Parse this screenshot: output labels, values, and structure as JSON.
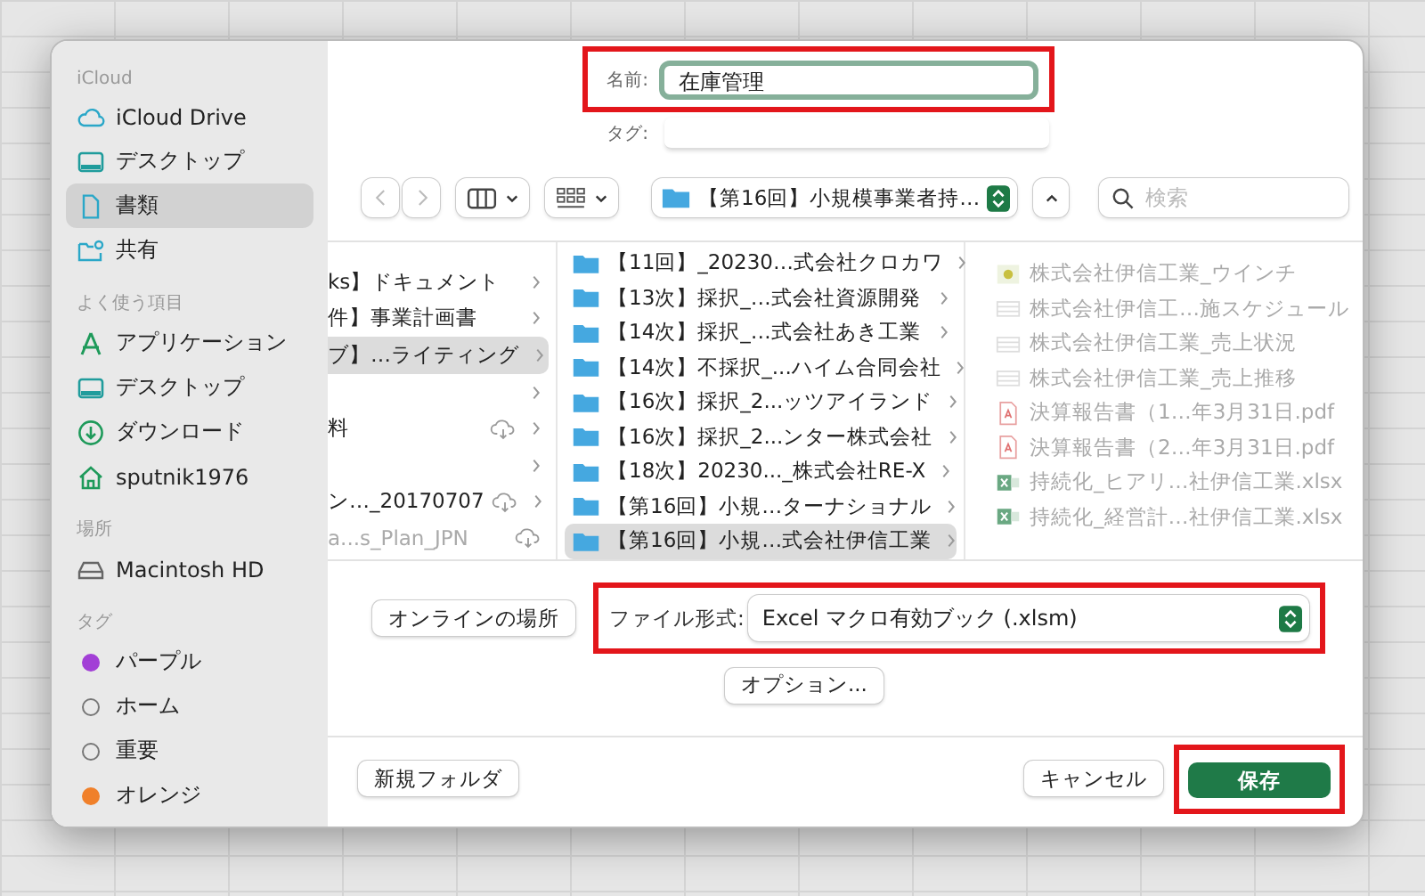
{
  "sidebar": {
    "sections": [
      {
        "heading": "iCloud",
        "items": [
          {
            "kind": "cloud",
            "label": "iCloud Drive",
            "selected": false
          },
          {
            "kind": "desktop",
            "label": "デスクトップ",
            "selected": false
          },
          {
            "kind": "document",
            "label": "書類",
            "selected": true
          },
          {
            "kind": "shared",
            "label": "共有",
            "selected": false
          }
        ]
      },
      {
        "heading": "よく使う項目",
        "items": [
          {
            "kind": "apps",
            "label": "アプリケーション",
            "selected": false
          },
          {
            "kind": "desktop",
            "label": "デスクトップ",
            "selected": false
          },
          {
            "kind": "download",
            "label": "ダウンロード",
            "selected": false
          },
          {
            "kind": "home",
            "label": "sputnik1976",
            "selected": false
          }
        ]
      },
      {
        "heading": "場所",
        "items": [
          {
            "kind": "drive",
            "label": "Macintosh HD",
            "selected": false
          }
        ]
      },
      {
        "heading": "タグ",
        "items": [
          {
            "kind": "tag",
            "color": "#a23fd6",
            "label": "パープル",
            "selected": false
          },
          {
            "kind": "tag",
            "label": "ホーム",
            "selected": false
          },
          {
            "kind": "tag",
            "label": "重要",
            "selected": false
          },
          {
            "kind": "tag",
            "color": "#f0802a",
            "label": "オレンジ",
            "selected": false
          }
        ]
      }
    ]
  },
  "save_form": {
    "name_label": "名前:",
    "name_value": "在庫管理",
    "name_highlighted": true,
    "tag_label": "タグ:"
  },
  "toolbar": {
    "nav_buttons": [
      {
        "kind": "back",
        "disabled": true
      },
      {
        "kind": "forward",
        "disabled": true
      }
    ],
    "path": "【第16回】小規模事業者持…",
    "search_placeholder": "検索"
  },
  "columns": [
    {
      "items": [
        {
          "label": "ks】ドキュメント",
          "kind": "item",
          "chevron": true,
          "cloud": false,
          "disabled": false,
          "selected": false
        },
        {
          "label": "件】事業計画書",
          "kind": "item",
          "chevron": true,
          "cloud": false,
          "disabled": false,
          "selected": false
        },
        {
          "label": "ブ】…ライティング",
          "kind": "item",
          "chevron": true,
          "cloud": false,
          "disabled": false,
          "selected": true
        },
        {
          "kind": "item",
          "chevron": true,
          "cloud": false,
          "disabled": false,
          "selected": false
        },
        {
          "label": "料",
          "kind": "item",
          "chevron": true,
          "cloud": true,
          "disabled": false,
          "selected": false
        },
        {
          "kind": "item",
          "chevron": true,
          "cloud": false,
          "disabled": false,
          "selected": false
        },
        {
          "label": "ン…_20170707",
          "kind": "item",
          "chevron": true,
          "cloud": true,
          "disabled": false,
          "selected": false
        },
        {
          "label": "a...s_Plan_JPN",
          "kind": "item",
          "chevron": false,
          "cloud": true,
          "disabled": true,
          "selected": false
        }
      ]
    },
    {
      "items": [
        {
          "label": "【11回】_20230…式会社クロカワ",
          "kind": "folder",
          "chevron": true,
          "cloud": false,
          "disabled": false,
          "selected": false
        },
        {
          "label": "【13次】採択_…式会社資源開発",
          "kind": "folder",
          "chevron": true,
          "cloud": false,
          "disabled": false,
          "selected": false
        },
        {
          "label": "【14次】採択_…式会社あき工業",
          "kind": "folder",
          "chevron": true,
          "cloud": false,
          "disabled": false,
          "selected": false
        },
        {
          "label": "【14次】不採択_...ハイム合同会社",
          "kind": "folder",
          "chevron": true,
          "cloud": false,
          "disabled": false,
          "selected": false
        },
        {
          "label": "【16次】採択_2...ッツアイランド",
          "kind": "folder",
          "chevron": true,
          "cloud": false,
          "disabled": false,
          "selected": false
        },
        {
          "label": "【16次】採択_2...ンター株式会社",
          "kind": "folder",
          "chevron": true,
          "cloud": false,
          "disabled": false,
          "selected": false
        },
        {
          "label": "【18次】20230..._株式会社RE-X",
          "kind": "folder",
          "chevron": true,
          "cloud": false,
          "disabled": false,
          "selected": false
        },
        {
          "label": "【第16回】小規…ターナショナル",
          "kind": "folder",
          "chevron": true,
          "cloud": false,
          "disabled": false,
          "selected": false
        },
        {
          "label": "【第16回】小規…式会社伊信工業",
          "kind": "folder",
          "chevron": true,
          "cloud": false,
          "disabled": false,
          "selected": true
        }
      ]
    },
    {
      "items": [
        {
          "label": "株式会社伊信工業_ウインチ",
          "kind": "image",
          "chevron": false,
          "cloud": false,
          "disabled": true,
          "selected": false
        },
        {
          "label": "株式会社伊信工…施スケジュール",
          "kind": "sheet",
          "chevron": false,
          "cloud": false,
          "disabled": true,
          "selected": false
        },
        {
          "label": "株式会社伊信工業_売上状況",
          "kind": "sheet",
          "chevron": false,
          "cloud": false,
          "disabled": true,
          "selected": false
        },
        {
          "label": "株式会社伊信工業_売上推移",
          "kind": "sheet",
          "chevron": false,
          "cloud": false,
          "disabled": true,
          "selected": false
        },
        {
          "label": "決算報告書（1…年3月31日.pdf",
          "kind": "pdf",
          "chevron": false,
          "cloud": false,
          "disabled": true,
          "selected": false
        },
        {
          "label": "決算報告書（2…年3月31日.pdf",
          "kind": "pdf",
          "chevron": false,
          "cloud": false,
          "disabled": true,
          "selected": false
        },
        {
          "label": "持続化_ヒアリ…社伊信工業.xlsx",
          "kind": "xlsx",
          "chevron": false,
          "cloud": false,
          "disabled": true,
          "selected": false
        },
        {
          "label": "持続化_経営計…社伊信工業.xlsx",
          "kind": "xlsx",
          "chevron": false,
          "cloud": false,
          "disabled": true,
          "selected": false
        }
      ]
    }
  ],
  "bottom": {
    "online_button": "オンラインの場所",
    "format_label": "ファイル形式:",
    "format_value": "Excel マクロ有効ブック (.xlsm)",
    "format_highlighted": true,
    "options_button": "オプション...",
    "new_folder_button": "新規フォルダ",
    "cancel_button": "キャンセル",
    "save_button": "保存",
    "save_highlighted": true
  }
}
